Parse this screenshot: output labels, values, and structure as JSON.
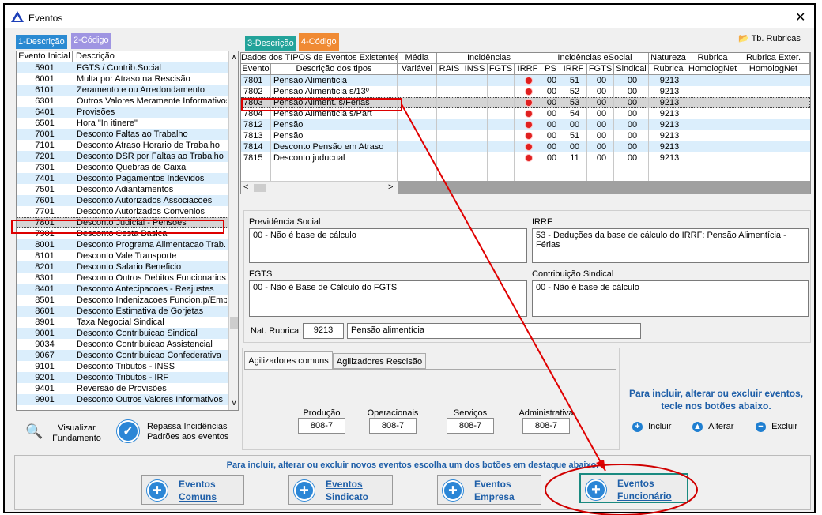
{
  "window": {
    "title": "Eventos",
    "close": "✕"
  },
  "left_tabs": [
    "1-Descrição",
    "2-Código"
  ],
  "right_tabs": [
    "3-Descrição",
    "4-Código"
  ],
  "tb_rubricas": "Tb. Rubricas",
  "left_list": {
    "headers": [
      "Evento Inicial",
      "Descrição"
    ],
    "rows": [
      [
        "5901",
        "FGTS / Contrib.Social"
      ],
      [
        "6001",
        "Multa por Atraso na Rescisão"
      ],
      [
        "6101",
        "Zeramento e ou Arredondamento"
      ],
      [
        "6301",
        "Outros Valores Meramente Informativos"
      ],
      [
        "6401",
        "Provisões"
      ],
      [
        "6501",
        "Hora \"In itinere\""
      ],
      [
        "7001",
        "Desconto Faltas ao Trabalho"
      ],
      [
        "7101",
        "Desconto Atraso Horario de Trabalho"
      ],
      [
        "7201",
        "Desconto DSR por Faltas ao Trabalho"
      ],
      [
        "7301",
        "Desconto Quebras de Caixa"
      ],
      [
        "7401",
        "Desconto Pagamentos Indevidos"
      ],
      [
        "7501",
        "Desconto Adiantamentos"
      ],
      [
        "7601",
        "Desconto Autorizados Associacoes"
      ],
      [
        "7701",
        "Desconto Autorizados Convenios"
      ],
      [
        "7801",
        "Desconto Judicial - Pensoes"
      ],
      [
        "7901",
        "Desconto Cesta Basica"
      ],
      [
        "8001",
        "Desconto Programa Alimentacao Trab."
      ],
      [
        "8101",
        "Desconto Vale Transporte"
      ],
      [
        "8201",
        "Desconto Salario Beneficio"
      ],
      [
        "8301",
        "Desconto Outros Debitos Funcionarios"
      ],
      [
        "8401",
        "Desconto Antecipacoes - Reajustes"
      ],
      [
        "8501",
        "Desconto Indenizacoes Funcion.p/Emp"
      ],
      [
        "8601",
        "Desconto Estimativa de Gorjetas"
      ],
      [
        "8901",
        "Taxa Negocial Sindical"
      ],
      [
        "9001",
        "Desconto Contribuicao Sindical"
      ],
      [
        "9034",
        "Desconto Contribuicao Assistencial"
      ],
      [
        "9067",
        "Desconto Contribuicao Confederativa"
      ],
      [
        "9101",
        "Desconto Tributos - INSS"
      ],
      [
        "9201",
        "Desconto Tributos - IRF"
      ],
      [
        "9401",
        "Reversão de Provisões"
      ],
      [
        "9901",
        "Desconto Outros Valores Informativos"
      ]
    ]
  },
  "right_grid": {
    "group_headers": [
      "Dados dos TIPOS de Eventos Existentes",
      "Média",
      "Incidências",
      "Incidências eSocial",
      "Natureza",
      "Rubrica",
      "Rubrica Exter."
    ],
    "headers": [
      "Evento",
      "Descrição dos tipos",
      "Variável",
      "RAIS",
      "INSS",
      "FGTS",
      "IRRF",
      "PS",
      "IRRF",
      "FGTS",
      "Sindical",
      "Rubrica",
      "HomologNet",
      "HomologNet"
    ],
    "rows": [
      {
        "evento": "7801",
        "desc": "Pensao Alimenticia",
        "irrf_dot": true,
        "ps": "00",
        "irrf": "51",
        "fgts": "00",
        "sind": "00",
        "rubrica": "9213"
      },
      {
        "evento": "7802",
        "desc": "Pensao Alimenticia s/13º",
        "irrf_dot": true,
        "ps": "00",
        "irrf": "52",
        "fgts": "00",
        "sind": "00",
        "rubrica": "9213"
      },
      {
        "evento": "7803",
        "desc": "Pensao Aliment. s/Ferias",
        "irrf_dot": true,
        "ps": "00",
        "irrf": "53",
        "fgts": "00",
        "sind": "00",
        "rubrica": "9213"
      },
      {
        "evento": "7804",
        "desc": "Pensao Alimenticia s/Part",
        "irrf_dot": true,
        "ps": "00",
        "irrf": "54",
        "fgts": "00",
        "sind": "00",
        "rubrica": "9213"
      },
      {
        "evento": "7812",
        "desc": "Pensão",
        "irrf_dot": true,
        "ps": "00",
        "irrf": "00",
        "fgts": "00",
        "sind": "00",
        "rubrica": "9213"
      },
      {
        "evento": "7813",
        "desc": "Pensão",
        "irrf_dot": true,
        "ps": "00",
        "irrf": "51",
        "fgts": "00",
        "sind": "00",
        "rubrica": "9213"
      },
      {
        "evento": "7814",
        "desc": "Desconto Pensão em Atraso",
        "irrf_dot": true,
        "ps": "00",
        "irrf": "00",
        "fgts": "00",
        "sind": "00",
        "rubrica": "9213"
      },
      {
        "evento": "7815",
        "desc": "Desconto juducual",
        "irrf_dot": true,
        "ps": "00",
        "irrf": "11",
        "fgts": "00",
        "sind": "00",
        "rubrica": "9213"
      }
    ]
  },
  "details": {
    "prev_label": "Previdência Social",
    "prev_value": "00 - Não é base de cálculo",
    "irrf_label": "IRRF",
    "irrf_value": "53 - Deduções da base de cálculo do IRRF: Pensão Alimentícia - Férias",
    "fgts_label": "FGTS",
    "fgts_value": "00 - Não é Base de Cálculo do FGTS",
    "sind_label": "Contribuição Sindical",
    "sind_value": "00 - Não é base de cálculo",
    "nat_label": "Nat. Rubrica:",
    "nat_code": "9213",
    "nat_desc": "Pensão alimentícia"
  },
  "agil": {
    "tabs": [
      "Agilizadores comuns",
      "Agilizadores Rescisão"
    ],
    "fields": [
      {
        "label": "Produção",
        "value": "808-7"
      },
      {
        "label": "Operacionais",
        "value": "808-7"
      },
      {
        "label": "Serviços",
        "value": "808-7"
      },
      {
        "label": "Administrativa",
        "value": "808-7"
      }
    ]
  },
  "help": {
    "text": "Para incluir, alterar ou excluir eventos, tecle nos botões abaixo.",
    "incluir": "Incluir",
    "alterar": "Alterar",
    "excluir": "Excluir"
  },
  "left_actions": {
    "visualizar": "Visualizar Fundamento",
    "repassa": "Repassa Incidências Padrões aos eventos"
  },
  "footer": {
    "text": "Para incluir, alterar ou excluir novos eventos escolha um dos botões em destaque abaixo.",
    "buttons": [
      [
        "Eventos",
        "Comuns"
      ],
      [
        "Eventos",
        "Sindicato"
      ],
      [
        "Eventos",
        "Empresa"
      ],
      [
        "Eventos",
        "Funcionário"
      ]
    ]
  },
  "colors": {
    "highlight": "#dd0000",
    "tab_blue": "#2a8ad2",
    "tab_orange": "#f08a33",
    "tab_teal": "#23a39a",
    "tab_violet": "#9f95e2"
  }
}
